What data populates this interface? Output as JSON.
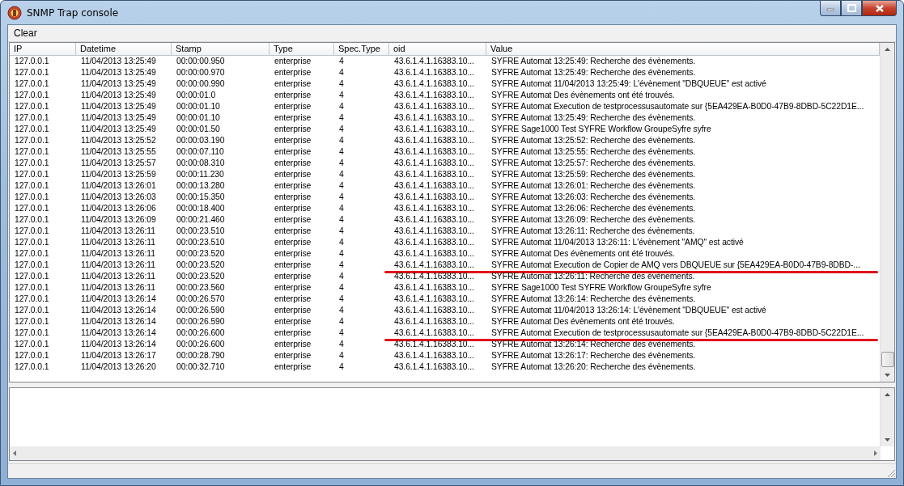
{
  "window": {
    "title": "SNMP Trap console"
  },
  "menu": [
    {
      "label": "Clear"
    }
  ],
  "table": {
    "columns": [
      "IP",
      "Datetime",
      "Stamp",
      "Type",
      "Spec.Type",
      "oid",
      "Value"
    ],
    "rows": [
      {
        "cells": [
          "127.0.0.1",
          "11/04/2013 13:25:49",
          "00:00:00.950",
          "enterprise",
          "4",
          "43.6.1.4.1.16383.10...",
          "SYFRE Automat 13:25:49: Recherche des évènements."
        ],
        "underlined": false
      },
      {
        "cells": [
          "127.0.0.1",
          "11/04/2013 13:25:49",
          "00:00:00.970",
          "enterprise",
          "4",
          "43.6.1.4.1.16383.10...",
          "SYFRE Automat 13:25:49: Recherche des évènements."
        ],
        "underlined": false
      },
      {
        "cells": [
          "127.0.0.1",
          "11/04/2013 13:25:49",
          "00:00:00.990",
          "enterprise",
          "4",
          "43.6.1.4.1.16383.10...",
          "SYFRE Automat 11/04/2013 13:25:49: L'évènement \"DBQUEUE\" est activé"
        ],
        "underlined": false
      },
      {
        "cells": [
          "127.0.0.1",
          "11/04/2013 13:25:49",
          "00:00:01.0",
          "enterprise",
          "4",
          "43.6.1.4.1.16383.10...",
          "SYFRE Automat Des évènements ont été trouvés."
        ],
        "underlined": false
      },
      {
        "cells": [
          "127.0.0.1",
          "11/04/2013 13:25:49",
          "00:00:01.10",
          "enterprise",
          "4",
          "43.6.1.4.1.16383.10...",
          "SYFRE Automat Execution de testprocessusautomate sur {5EA429EA-B0D0-47B9-8DBD-5C22D1E..."
        ],
        "underlined": false
      },
      {
        "cells": [
          "127.0.0.1",
          "11/04/2013 13:25:49",
          "00:00:01.10",
          "enterprise",
          "4",
          "43.6.1.4.1.16383.10...",
          "SYFRE Automat 13:25:49: Recherche des évènements."
        ],
        "underlined": false
      },
      {
        "cells": [
          "127.0.0.1",
          "11/04/2013 13:25:49",
          "00:00:01.50",
          "enterprise",
          "4",
          "43.6.1.4.1.16383.10...",
          "SYFRE  Sage1000 Test SYFRE Workflow  GroupeSyfre syfre"
        ],
        "underlined": false
      },
      {
        "cells": [
          "127.0.0.1",
          "11/04/2013 13:25:52",
          "00:00:03.190",
          "enterprise",
          "4",
          "43.6.1.4.1.16383.10...",
          "SYFRE Automat 13:25:52: Recherche des évènements."
        ],
        "underlined": false
      },
      {
        "cells": [
          "127.0.0.1",
          "11/04/2013 13:25:55",
          "00:00:07.110",
          "enterprise",
          "4",
          "43.6.1.4.1.16383.10...",
          "SYFRE Automat 13:25:55: Recherche des évènements."
        ],
        "underlined": false
      },
      {
        "cells": [
          "127.0.0.1",
          "11/04/2013 13:25:57",
          "00:00:08.310",
          "enterprise",
          "4",
          "43.6.1.4.1.16383.10...",
          "SYFRE Automat 13:25:57: Recherche des évènements."
        ],
        "underlined": false
      },
      {
        "cells": [
          "127.0.0.1",
          "11/04/2013 13:25:59",
          "00:00:11.230",
          "enterprise",
          "4",
          "43.6.1.4.1.16383.10...",
          "SYFRE Automat 13:25:59: Recherche des évènements."
        ],
        "underlined": false
      },
      {
        "cells": [
          "127.0.0.1",
          "11/04/2013 13:26:01",
          "00:00:13.280",
          "enterprise",
          "4",
          "43.6.1.4.1.16383.10...",
          "SYFRE Automat 13:26:01: Recherche des évènements."
        ],
        "underlined": false
      },
      {
        "cells": [
          "127.0.0.1",
          "11/04/2013 13:26:03",
          "00:00:15.350",
          "enterprise",
          "4",
          "43.6.1.4.1.16383.10...",
          "SYFRE Automat 13:26:03: Recherche des évènements."
        ],
        "underlined": false
      },
      {
        "cells": [
          "127.0.0.1",
          "11/04/2013 13:26:06",
          "00:00:18.400",
          "enterprise",
          "4",
          "43.6.1.4.1.16383.10...",
          "SYFRE Automat 13:26:06: Recherche des évènements."
        ],
        "underlined": false
      },
      {
        "cells": [
          "127.0.0.1",
          "11/04/2013 13:26:09",
          "00:00:21.460",
          "enterprise",
          "4",
          "43.6.1.4.1.16383.10...",
          "SYFRE Automat 13:26:09: Recherche des évènements."
        ],
        "underlined": false
      },
      {
        "cells": [
          "127.0.0.1",
          "11/04/2013 13:26:11",
          "00:00:23.510",
          "enterprise",
          "4",
          "43.6.1.4.1.16383.10...",
          "SYFRE Automat 13:26:11: Recherche des évènements."
        ],
        "underlined": false
      },
      {
        "cells": [
          "127.0.0.1",
          "11/04/2013 13:26:11",
          "00:00:23.510",
          "enterprise",
          "4",
          "43.6.1.4.1.16383.10...",
          "SYFRE Automat 11/04/2013 13:26:11: L'évènement \"AMQ\" est activé"
        ],
        "underlined": false
      },
      {
        "cells": [
          "127.0.0.1",
          "11/04/2013 13:26:11",
          "00:00:23.520",
          "enterprise",
          "4",
          "43.6.1.4.1.16383.10...",
          "SYFRE Automat Des évènements ont été trouvés."
        ],
        "underlined": false
      },
      {
        "cells": [
          "127.0.0.1",
          "11/04/2013 13:26:11",
          "00:00:23.520",
          "enterprise",
          "4",
          "43.6.1.4.1.16383.10...",
          "SYFRE Automat Execution de Copier de AMQ vers DBQUEUE sur {5EA429EA-B0D0-47B9-8DBD-..."
        ],
        "underlined": true
      },
      {
        "cells": [
          "127.0.0.1",
          "11/04/2013 13:26:11",
          "00:00:23.520",
          "enterprise",
          "4",
          "43.6.1.4.1.16383.10...",
          "SYFRE Automat 13:26:11: Recherche des évènements."
        ],
        "underlined": false
      },
      {
        "cells": [
          "127.0.0.1",
          "11/04/2013 13:26:11",
          "00:00:23.560",
          "enterprise",
          "4",
          "43.6.1.4.1.16383.10...",
          "SYFRE  Sage1000 Test SYFRE Workflow  GroupeSyfre syfre"
        ],
        "underlined": false
      },
      {
        "cells": [
          "127.0.0.1",
          "11/04/2013 13:26:14",
          "00:00:26.570",
          "enterprise",
          "4",
          "43.6.1.4.1.16383.10...",
          "SYFRE Automat 13:26:14: Recherche des évènements."
        ],
        "underlined": false
      },
      {
        "cells": [
          "127.0.0.1",
          "11/04/2013 13:26:14",
          "00:00:26.590",
          "enterprise",
          "4",
          "43.6.1.4.1.16383.10...",
          "SYFRE Automat 11/04/2013 13:26:14: L'évènement \"DBQUEUE\" est activé"
        ],
        "underlined": false
      },
      {
        "cells": [
          "127.0.0.1",
          "11/04/2013 13:26:14",
          "00:00:26.590",
          "enterprise",
          "4",
          "43.6.1.4.1.16383.10...",
          "SYFRE Automat Des évènements ont été trouvés."
        ],
        "underlined": false
      },
      {
        "cells": [
          "127.0.0.1",
          "11/04/2013 13:26:14",
          "00:00:26.600",
          "enterprise",
          "4",
          "43.6.1.4.1.16383.10...",
          "SYFRE Automat Execution de testprocessusautomate sur {5EA429EA-B0D0-47B9-8DBD-5C22D1E..."
        ],
        "underlined": true
      },
      {
        "cells": [
          "127.0.0.1",
          "11/04/2013 13:26:14",
          "00:00:26.600",
          "enterprise",
          "4",
          "43.6.1.4.1.16383.10...",
          "SYFRE Automat 13:26:14: Recherche des évènements."
        ],
        "underlined": false
      },
      {
        "cells": [
          "127.0.0.1",
          "11/04/2013 13:26:17",
          "00:00:28.790",
          "enterprise",
          "4",
          "43.6.1.4.1.16383.10...",
          "SYFRE Automat 13:26:17: Recherche des évènements."
        ],
        "underlined": false
      },
      {
        "cells": [
          "127.0.0.1",
          "11/04/2013 13:26:20",
          "00:00:32.710",
          "enterprise",
          "4",
          "43.6.1.4.1.16383.10...",
          "SYFRE Automat 13:26:20: Recherche des évènements."
        ],
        "underlined": false
      }
    ]
  }
}
